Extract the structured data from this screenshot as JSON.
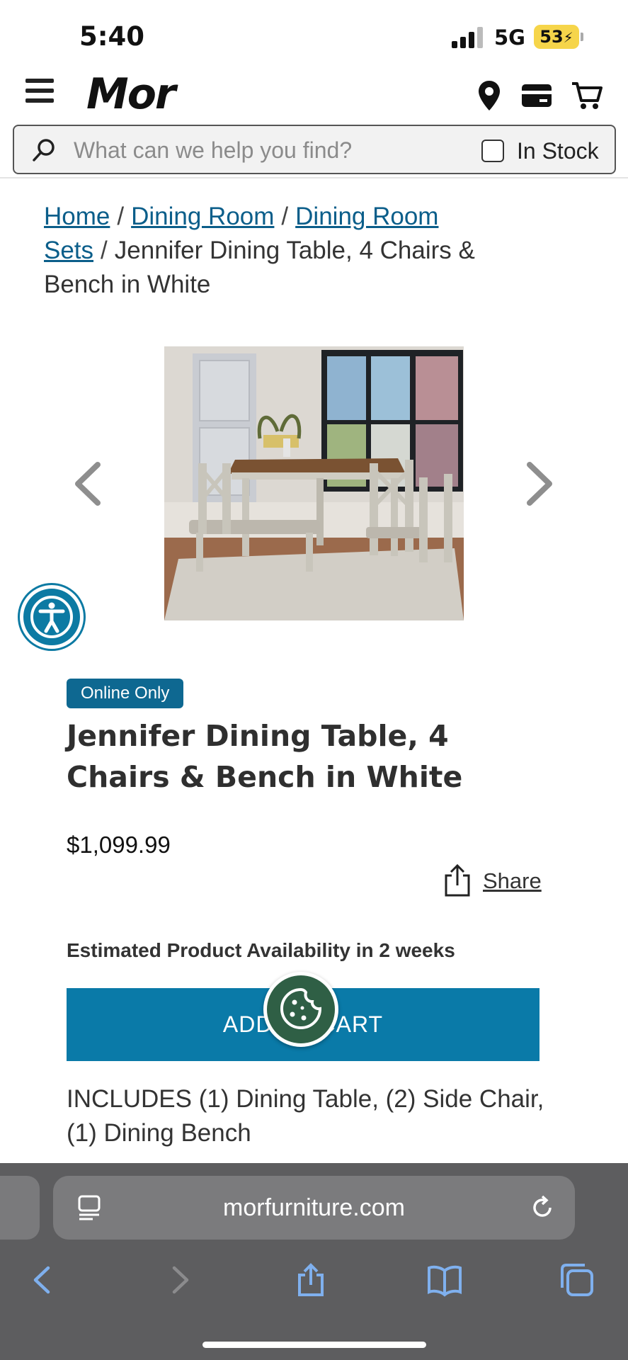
{
  "status_bar": {
    "time": "5:40",
    "network": "5G",
    "battery": "53"
  },
  "header": {
    "logo": "Mor"
  },
  "search": {
    "placeholder": "What can we help you find?",
    "in_stock_label": "In Stock"
  },
  "breadcrumb": {
    "items": [
      "Home",
      "Dining Room",
      "Dining Room Sets"
    ],
    "current": "Jennifer Dining Table, 4 Chairs & Bench in White",
    "separator": "/"
  },
  "product": {
    "badge": "Online Only",
    "title": "Jennifer Dining Table, 4 Chairs & Bench in White",
    "price": "$1,099.99",
    "share_label": "Share",
    "availability": "Estimated Product Availability in 2 weeks",
    "add_to_cart_label": "ADD TO CART",
    "includes": "INCLUDES (1) Dining Table, (2) Side Chair, (1) Dining Bench"
  },
  "browser": {
    "url": "morfurniture.com"
  },
  "colors": {
    "brand_blue": "#0a7aa8",
    "link": "#0b5e8a",
    "badge": "#0e6891",
    "cookie": "#2f5f45",
    "battery": "#f6d54a"
  },
  "icons": [
    "menu-icon",
    "location-pin-icon",
    "credit-card-icon",
    "cart-icon",
    "search-icon",
    "chevron-left-icon",
    "chevron-right-icon",
    "accessibility-icon",
    "share-icon",
    "cookie-icon",
    "reader-icon",
    "reload-icon",
    "back-icon",
    "forward-icon",
    "bookmarks-icon",
    "tabs-icon"
  ]
}
